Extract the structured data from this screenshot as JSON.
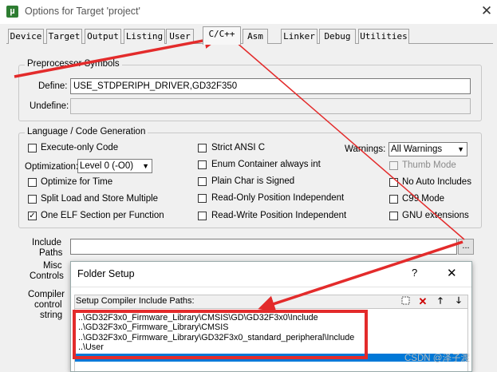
{
  "window": {
    "title": "Options for Target 'project'",
    "close_glyph": "✕"
  },
  "tabs": [
    "Device",
    "Target",
    "Output",
    "Listing",
    "User",
    "C/C++",
    "Asm",
    "Linker",
    "Debug",
    "Utilities"
  ],
  "active_tab": "C/C++",
  "preprocessor": {
    "legend": "Preprocessor Symbols",
    "define_label": "Define:",
    "define_value": "USE_STDPERIPH_DRIVER,GD32F350",
    "undefine_label": "Undefine:",
    "undefine_value": ""
  },
  "language": {
    "legend": "Language / Code Generation",
    "execute_only": {
      "label": "Execute-only Code",
      "checked": false
    },
    "optimization_label": "Optimization:",
    "optimization_value": "Level 0 (-O0)",
    "optimize_time": {
      "label": "Optimize for Time",
      "checked": false
    },
    "split_load": {
      "label": "Split Load and Store Multiple",
      "checked": false
    },
    "one_elf": {
      "label": "One ELF Section per Function",
      "checked": true
    },
    "strict_ansi": {
      "label": "Strict ANSI C",
      "checked": false
    },
    "enum_container": {
      "label": "Enum Container always int",
      "checked": false
    },
    "plain_char": {
      "label": "Plain Char is Signed",
      "checked": false
    },
    "ropi": {
      "label": "Read-Only Position Independent",
      "checked": false
    },
    "rwpi": {
      "label": "Read-Write Position Independent",
      "checked": false
    },
    "warnings_label": "Warnings:",
    "warnings_value": "All Warnings",
    "thumb_mode": {
      "label": "Thumb Mode",
      "checked": false,
      "disabled": true
    },
    "no_auto_includes": {
      "label": "No Auto Includes",
      "checked": false
    },
    "c99_mode": {
      "label": "C99 Mode",
      "checked": false
    },
    "gnu_ext": {
      "label": "GNU extensions",
      "checked": false
    }
  },
  "include_paths_label_1": "Include",
  "include_paths_label_2": "Paths",
  "misc_label_1": "Misc",
  "misc_label_2": "Controls",
  "compiler_label_1": "Compiler",
  "compiler_label_2": "control",
  "compiler_label_3": "string",
  "browse_label": "...",
  "folder_setup": {
    "title": "Folder Setup",
    "help": "?",
    "close": "✕",
    "caption": "Setup Compiler Include Paths:",
    "paths": [
      "..\\GD32F3x0_Firmware_Library\\CMSIS\\GD\\GD32F3x0\\Include",
      "..\\GD32F3x0_Firmware_Library\\CMSIS",
      "..\\GD32F3x0_Firmware_Library\\GD32F3x0_standard_peripheral\\Include",
      "..\\User"
    ]
  },
  "watermark": "CSDN @泽子渡",
  "colors": {
    "annotation_red": "#e32b2b",
    "selection_blue": "#0078d7"
  }
}
